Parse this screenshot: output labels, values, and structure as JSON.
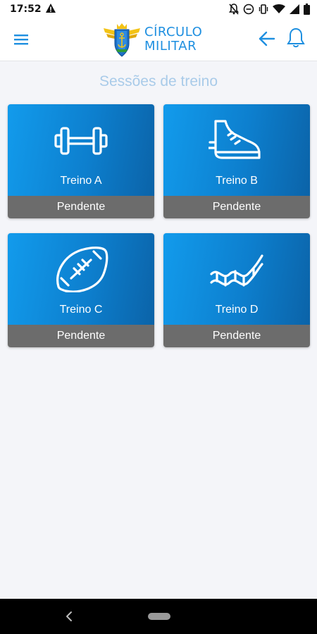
{
  "status_bar": {
    "time": "17:52"
  },
  "header": {
    "logo_line1": "CÍRCULO",
    "logo_line2": "MILITAR"
  },
  "section_title": "Sessões de treino",
  "cards": [
    {
      "title": "Treino A",
      "status": "Pendente",
      "icon": "dumbbell-icon"
    },
    {
      "title": "Treino B",
      "status": "Pendente",
      "icon": "sneaker-icon"
    },
    {
      "title": "Treino C",
      "status": "Pendente",
      "icon": "football-icon"
    },
    {
      "title": "Treino D",
      "status": "Pendente",
      "icon": "dna-icon"
    }
  ],
  "colors": {
    "accent": "#1e8fe0",
    "card_gradient_start": "#129bec",
    "card_gradient_end": "#0b63a8",
    "status_bar_bg": "#6c6c6c",
    "background": "#f4f5f9"
  }
}
